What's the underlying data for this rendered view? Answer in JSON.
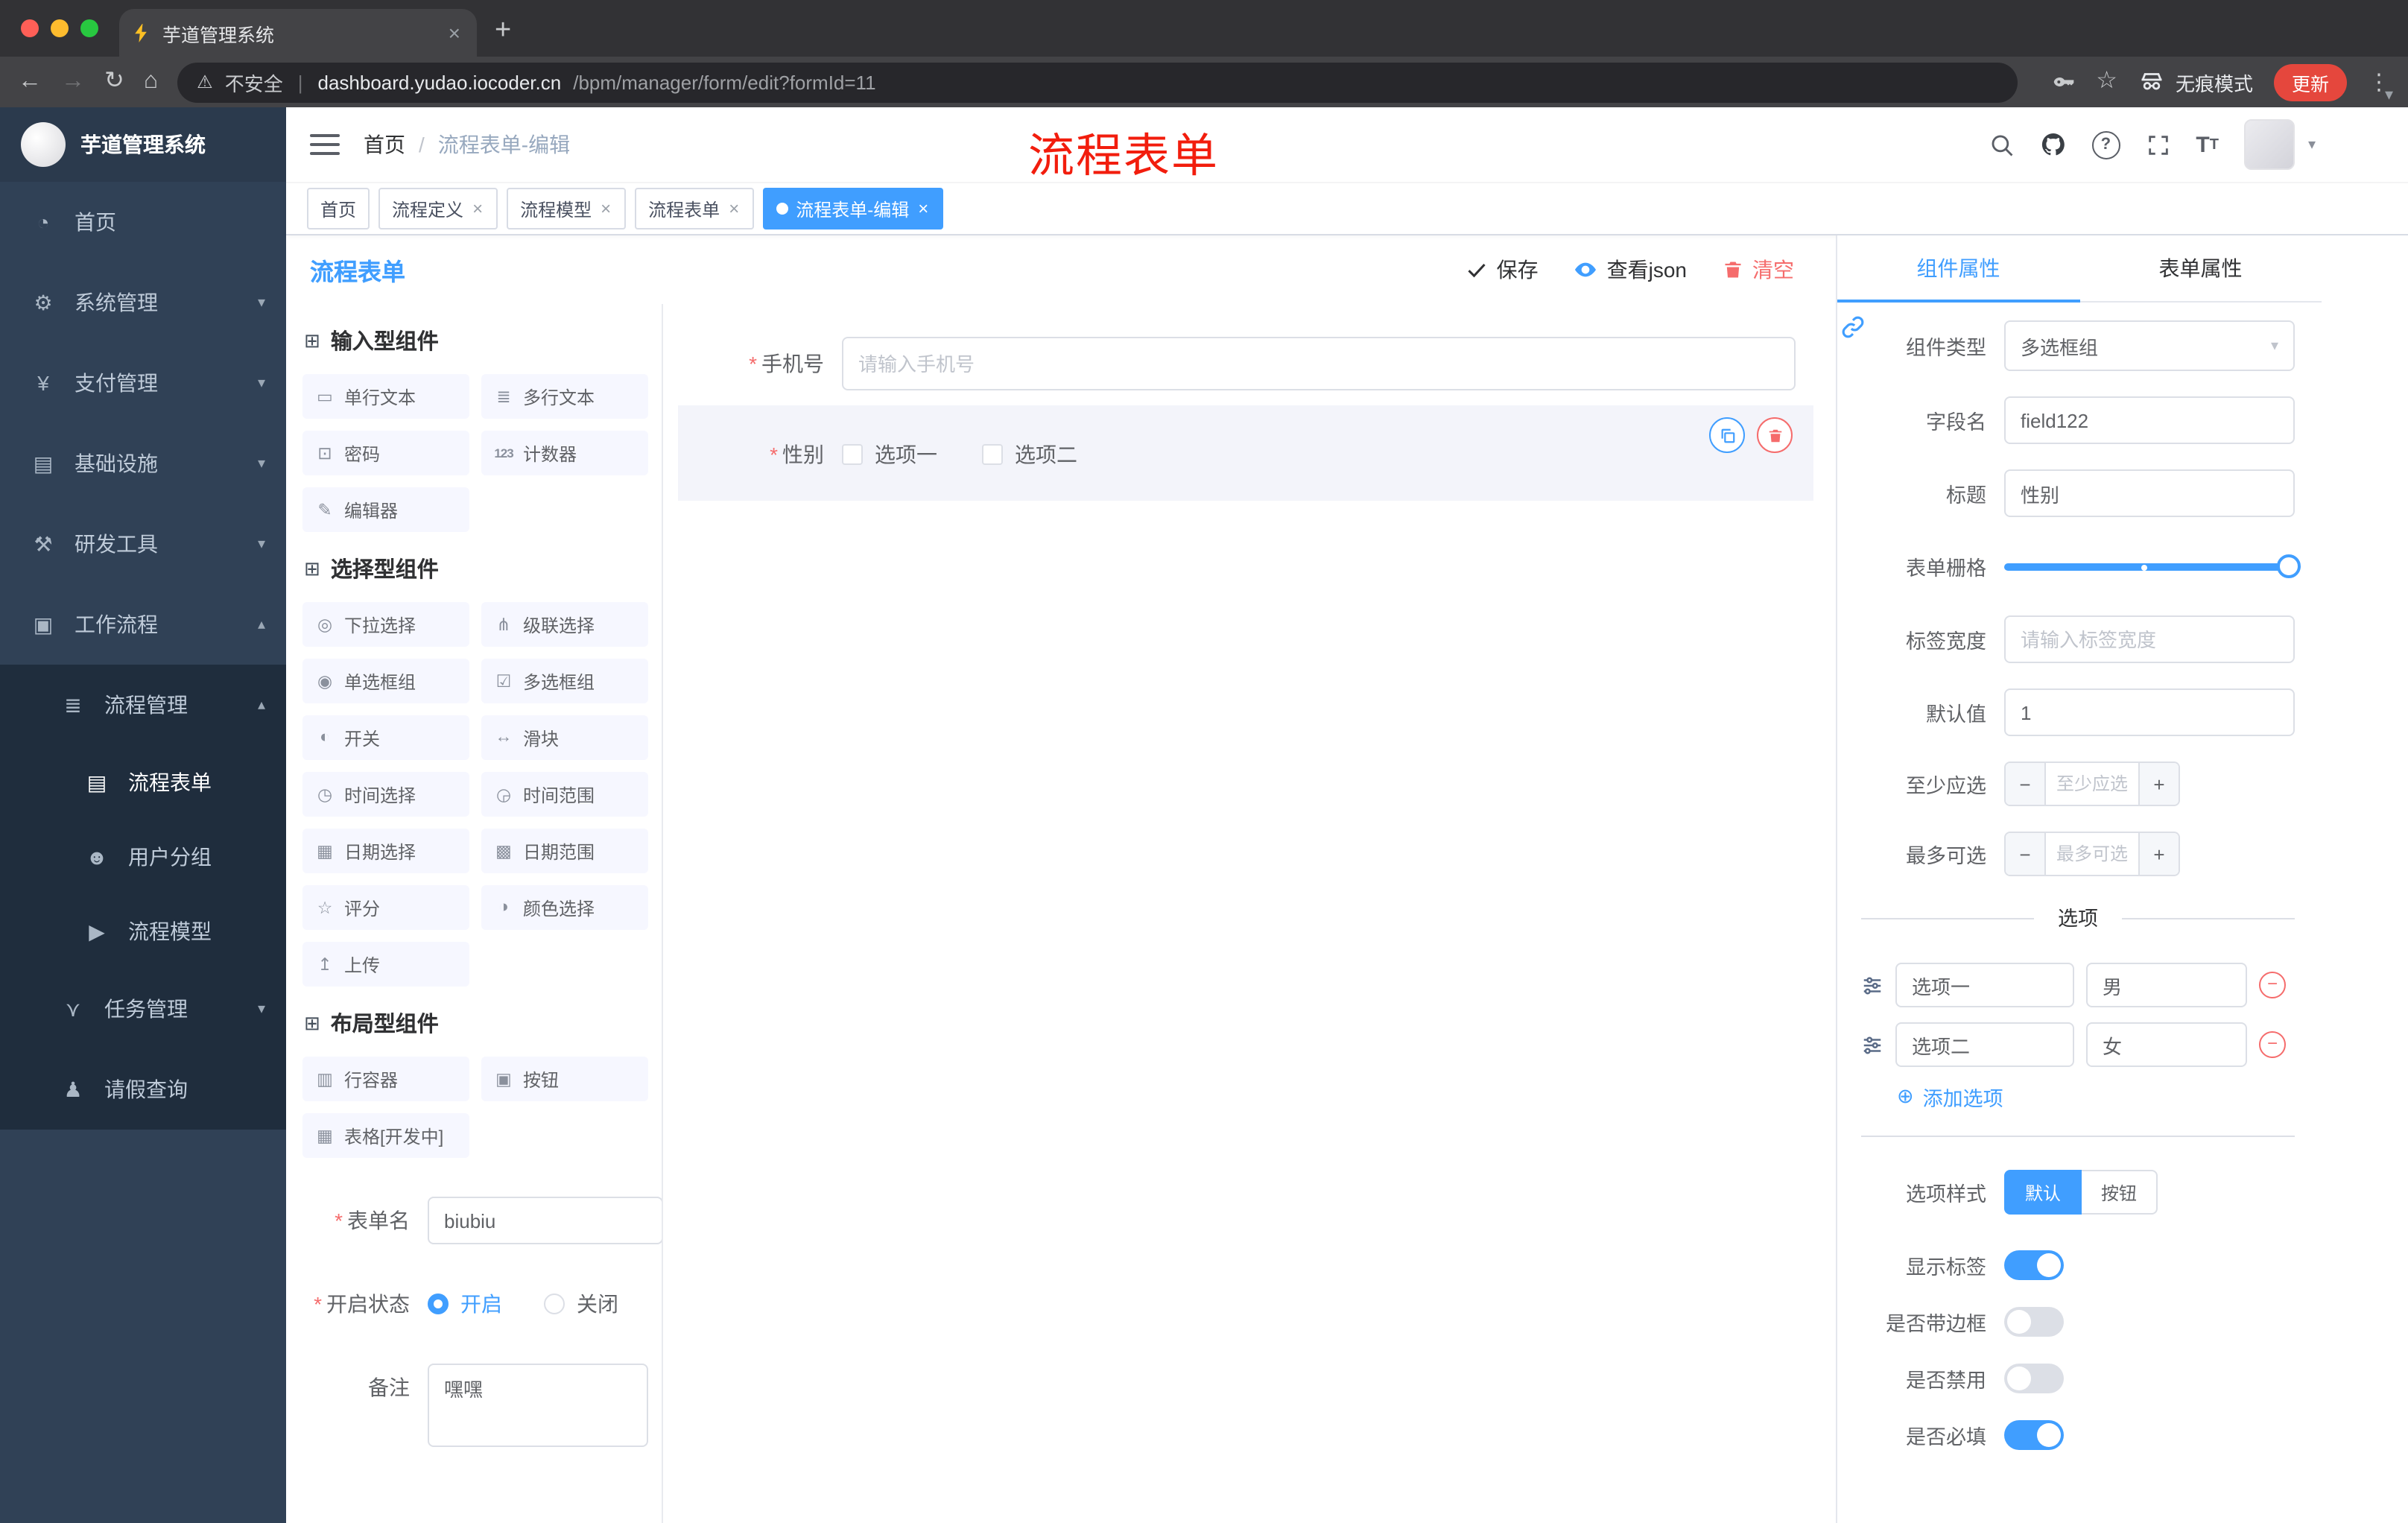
{
  "colors": {
    "accent": "#409eff",
    "danger": "#f56c6c",
    "annotation": "#f21d0d",
    "sidebar_bg": "#304156",
    "submenu_bg": "#1f2d3d",
    "tag_active": "#409eff",
    "update_btn": "#e5473d"
  },
  "browser": {
    "tab_title": "芋道管理系统",
    "close_glyph": "×",
    "newtab_glyph": "+",
    "back_glyph": "←",
    "forward_glyph": "→",
    "reload_glyph": "↻",
    "home_glyph": "⌂",
    "warning_glyph": "⚠",
    "security_text": "不安全",
    "divider_glyph": "|",
    "url_domain": "dashboard.yudao.iocoder.cn",
    "url_path": "/bpm/manager/form/edit?formId=11",
    "star_glyph": "☆",
    "incognito_label": "无痕模式",
    "update_label": "更新",
    "kebab_glyph": "⋮",
    "chevron_glyph": "▾"
  },
  "sidebar": {
    "logo_title": "芋道管理系统",
    "menu": [
      {
        "label": "首页",
        "icon": "◔",
        "arrow": ""
      },
      {
        "label": "系统管理",
        "icon": "⚙",
        "arrow": "▾"
      },
      {
        "label": "支付管理",
        "icon": "¥",
        "arrow": "▾"
      },
      {
        "label": "基础设施",
        "icon": "▤",
        "arrow": "▾"
      },
      {
        "label": "研发工具",
        "icon": "⚒",
        "arrow": "▾"
      },
      {
        "label": "工作流程",
        "icon": "▣",
        "arrow": "▴"
      }
    ],
    "process_group": {
      "label": "流程管理",
      "icon": "≣",
      "arrow": "▴"
    },
    "process_children": [
      {
        "label": "流程表单",
        "icon": "▤"
      },
      {
        "label": "用户分组",
        "icon": "☻"
      },
      {
        "label": "流程模型",
        "icon": "▶"
      }
    ],
    "workflow_siblings": [
      {
        "label": "任务管理",
        "icon": "⋎",
        "arrow": "▾"
      },
      {
        "label": "请假查询",
        "icon": "♟",
        "arrow": ""
      }
    ]
  },
  "header": {
    "breadcrumb_home": "首页",
    "breadcrumb_sep": "/",
    "breadcrumb_current": "流程表单-编辑",
    "annotation": "流程表单"
  },
  "tags": {
    "close_glyph": "×",
    "items": [
      {
        "label": "首页"
      },
      {
        "label": "流程定义"
      },
      {
        "label": "流程模型"
      },
      {
        "label": "流程表单"
      },
      {
        "label": "流程表单-编辑"
      }
    ]
  },
  "designer": {
    "title": "流程表单",
    "save_label": "保存",
    "view_json_label": "查看json",
    "clear_label": "清空",
    "group_icon": "⊞",
    "groups": [
      {
        "title": "输入型组件",
        "items": [
          {
            "label": "单行文本",
            "icon": "▭"
          },
          {
            "label": "多行文本",
            "icon": "≣"
          },
          {
            "label": "密码",
            "icon": "⊡"
          },
          {
            "label": "计数器",
            "icon": "123"
          },
          {
            "label": "编辑器",
            "icon": "✎"
          }
        ]
      },
      {
        "title": "选择型组件",
        "items": [
          {
            "label": "下拉选择",
            "icon": "◎"
          },
          {
            "label": "级联选择",
            "icon": "⋔"
          },
          {
            "label": "单选框组",
            "icon": "◉"
          },
          {
            "label": "多选框组",
            "icon": "☑"
          },
          {
            "label": "开关",
            "icon": "◐"
          },
          {
            "label": "滑块",
            "icon": "↔"
          },
          {
            "label": "时间选择",
            "icon": "◷"
          },
          {
            "label": "时间范围",
            "icon": "◶"
          },
          {
            "label": "日期选择",
            "icon": "▦"
          },
          {
            "label": "日期范围",
            "icon": "▩"
          },
          {
            "label": "评分",
            "icon": "☆"
          },
          {
            "label": "颜色选择",
            "icon": "◑"
          },
          {
            "label": "上传",
            "icon": "↥"
          }
        ]
      },
      {
        "title": "布局型组件",
        "items": [
          {
            "label": "行容器",
            "icon": "▥"
          },
          {
            "label": "按钮",
            "icon": "▣"
          },
          {
            "label": "表格[开发中]",
            "icon": "▦"
          }
        ]
      }
    ],
    "meta": {
      "required_glyph": "*",
      "name_label": "表单名",
      "name_value": "biubiu",
      "status_label": "开启状态",
      "status_on": "开启",
      "status_off": "关闭",
      "remark_label": "备注",
      "remark_value": "嘿嘿"
    },
    "canvas": {
      "phone_label": "手机号",
      "phone_placeholder": "请输入手机号",
      "gender_label": "性别",
      "gender_opt1": "选项一",
      "gender_opt2": "选项二"
    }
  },
  "inspector": {
    "tab_component": "组件属性",
    "tab_form": "表单属性",
    "type_label": "组件类型",
    "type_value": "多选框组",
    "select_caret": "▾",
    "field_label": "字段名",
    "field_value": "field122",
    "title_label": "标题",
    "title_value": "性别",
    "grid_label": "表单栅格",
    "width_label": "标签宽度",
    "width_placeholder": "请输入标签宽度",
    "default_label": "默认值",
    "default_value": "1",
    "min_label": "至少应选",
    "min_placeholder": "至少应选",
    "max_label": "最多可选",
    "max_placeholder": "最多可选",
    "minus_glyph": "−",
    "plus_glyph": "+",
    "options_title": "选项",
    "options": [
      {
        "label": "选项一",
        "value": "男"
      },
      {
        "label": "选项二",
        "value": "女"
      }
    ],
    "add_glyph": "⊕",
    "add_option_label": "添加选项",
    "style_label": "选项样式",
    "style_options": [
      "默认",
      "按钮"
    ],
    "switch_rows": [
      {
        "label": "显示标签",
        "state": "on"
      },
      {
        "label": "是否带边框",
        "state": "off"
      },
      {
        "label": "是否禁用",
        "state": "off"
      },
      {
        "label": "是否必填",
        "state": "on"
      }
    ]
  }
}
